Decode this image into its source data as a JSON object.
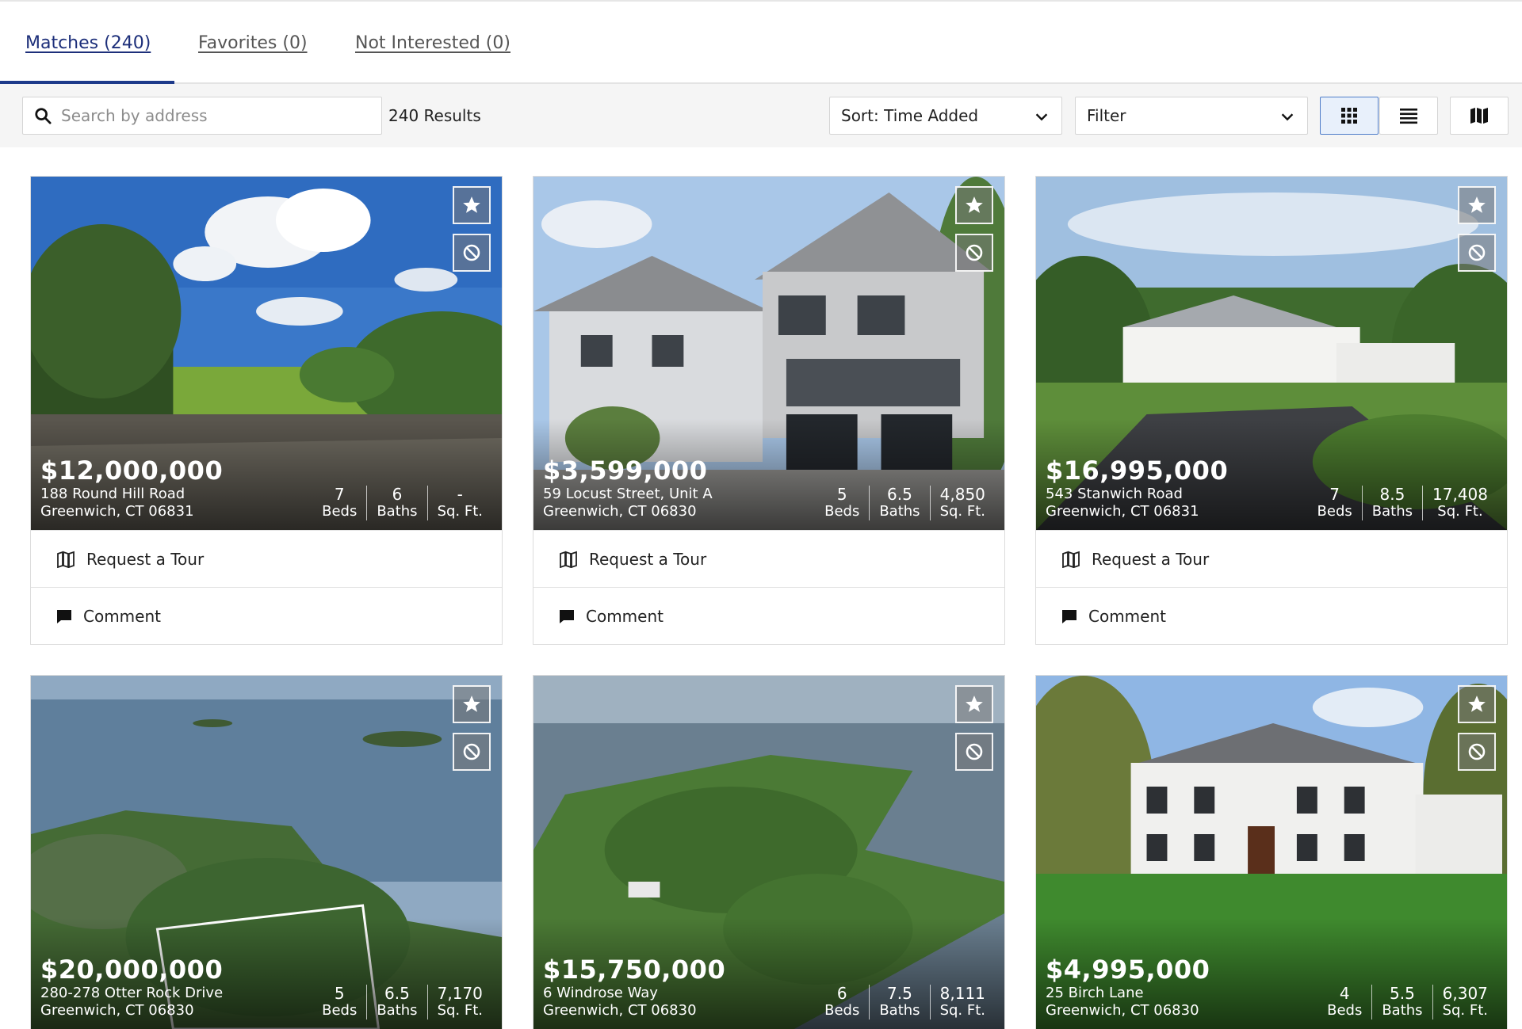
{
  "tabs": [
    {
      "label": "Matches (240)"
    },
    {
      "label": "Favorites (0)"
    },
    {
      "label": "Not Interested (0)"
    }
  ],
  "toolbar": {
    "search_placeholder": "Search by address",
    "results_label": "240 Results",
    "sort_label": "Sort: Time Added",
    "filter_label": "Filter"
  },
  "actions": {
    "tour_label": "Request a Tour",
    "comment_label": "Comment"
  },
  "stat_labels": {
    "beds": "Beds",
    "baths": "Baths",
    "sqft": "Sq. Ft."
  },
  "listings": [
    {
      "price": "$12,000,000",
      "street": "188 Round Hill Road",
      "city": "Greenwich, CT 06831",
      "beds": "7",
      "baths": "6",
      "sqft": "-"
    },
    {
      "price": "$3,599,000",
      "street": "59 Locust Street, Unit A",
      "city": "Greenwich, CT 06830",
      "beds": "5",
      "baths": "6.5",
      "sqft": "4,850"
    },
    {
      "price": "$16,995,000",
      "street": "543 Stanwich Road",
      "city": "Greenwich, CT 06831",
      "beds": "7",
      "baths": "8.5",
      "sqft": "17,408"
    },
    {
      "price": "$20,000,000",
      "street": "280-278 Otter Rock Drive",
      "city": "Greenwich, CT 06830",
      "beds": "5",
      "baths": "6.5",
      "sqft": "7,170"
    },
    {
      "price": "$15,750,000",
      "street": "6 Windrose Way",
      "city": "Greenwich, CT 06830",
      "beds": "6",
      "baths": "7.5",
      "sqft": "8,111"
    },
    {
      "price": "$4,995,000",
      "street": "25 Birch Lane",
      "city": "Greenwich, CT 06830",
      "beds": "4",
      "baths": "5.5",
      "sqft": "6,307"
    }
  ],
  "colors": {
    "accent": "#1d3a8a",
    "active_view_bg": "#e8f0fb"
  }
}
